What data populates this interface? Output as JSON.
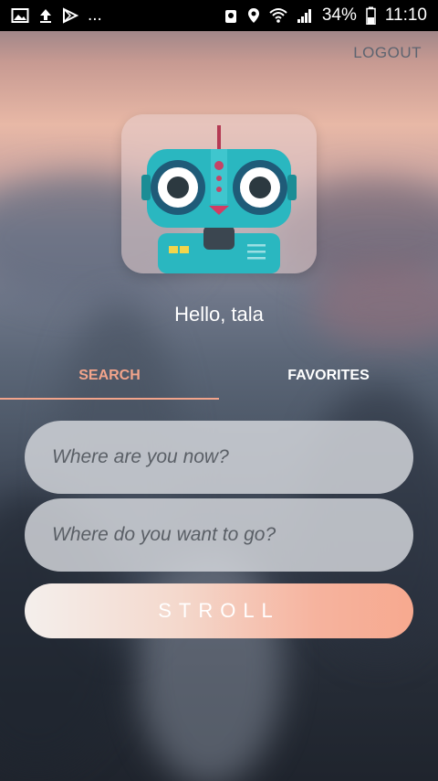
{
  "status_bar": {
    "battery": "34%",
    "time": "11:10",
    "ellipsis": "..."
  },
  "header": {
    "logout_label": "LOGOUT"
  },
  "profile": {
    "greeting": "Hello, tala"
  },
  "tabs": [
    {
      "label": "SEARCH",
      "active": true
    },
    {
      "label": "FAVORITES",
      "active": false
    }
  ],
  "form": {
    "origin_placeholder": "Where are you now?",
    "destination_placeholder": "Where do you want to go?",
    "submit_label": "STROLL"
  },
  "colors": {
    "accent": "#f2a48b",
    "robot_body": "#2ab7c0"
  }
}
